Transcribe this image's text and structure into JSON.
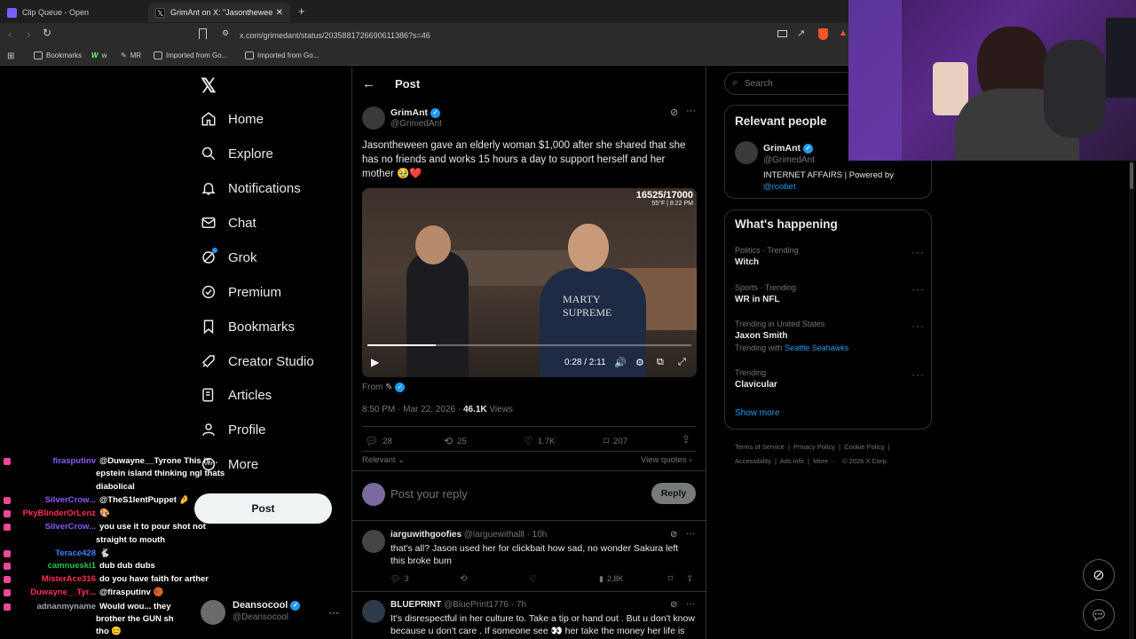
{
  "browser": {
    "tabs": [
      {
        "label": "Clip Queue - Open"
      },
      {
        "label": "GrimAnt on X: \"Jasontheween ga"
      }
    ],
    "url": "x.com/grimedant/status/2035881726690611386?s=46",
    "bookmarks": [
      "Bookmarks",
      "w",
      "MR",
      "Imported from Go...",
      "Imported from Go..."
    ]
  },
  "nav": {
    "items": [
      "Home",
      "Explore",
      "Notifications",
      "Chat",
      "Grok",
      "Premium",
      "Bookmarks",
      "Creator Studio",
      "Articles",
      "Profile",
      "More"
    ],
    "post_button": "Post"
  },
  "header": {
    "title": "Post"
  },
  "tweet": {
    "author": "GrimAnt",
    "handle": "@GrimedAnt",
    "text": "Jasontheween gave an elderly woman $1,000 after she shared that she has no friends and works 15 hours a day to support herself and her mother 🥹❤️",
    "video": {
      "overlay_count": "16525/17000",
      "overlay_meta": "55°F | 8:22 PM",
      "shirt_text_1": "MARTY",
      "shirt_text_2": "SUPREME",
      "time": "0:28 / 2:11",
      "progress": 0.21
    },
    "from_label": "From",
    "timestamp": "8:50 PM · Mar 22, 2026 ·",
    "views_count": "46.1K",
    "views_label": "Views",
    "stats": {
      "replies": "28",
      "reposts": "25",
      "likes": "1.7K",
      "bookmarks": "207"
    },
    "sort_label": "Relevant",
    "view_quotes": "View quotes"
  },
  "reply_box": {
    "placeholder": "Post your reply",
    "button": "Reply"
  },
  "replies": [
    {
      "name": "iarguwithgoofies",
      "handle": "@larguewithalll",
      "time": "· 10h",
      "text": "that's all? Jason used her for clickbait how sad, no wonder Sakura left this broke bum",
      "replies": "3",
      "views": "2.8K"
    },
    {
      "name": "BLUEPRINT",
      "handle": "@BluePrint1776",
      "time": "· 7h",
      "text": "It's disrespectful in her culture  to. Take a tip or hand out . But u don't know because u don't care . If someone see 👀  her take the money  her life is"
    }
  ],
  "sidebar_account": {
    "name": "Deansocool",
    "handle": "@Deansocool"
  },
  "right": {
    "search_placeholder": "Search",
    "relevant_title": "Relevant people",
    "relevant_person": {
      "name": "GrimAnt",
      "handle": "@GrimedAnt",
      "bio": "INTERNET AFFAIRS | Powered by",
      "bio_link": "@roobet"
    },
    "happening_title": "What's happening",
    "trends": [
      {
        "category": "Politics · Trending",
        "name": "Witch"
      },
      {
        "category": "Sports · Trending",
        "name": "WR in NFL"
      },
      {
        "category": "Trending in United States",
        "name": "Jaxon Smith",
        "extra_prefix": "Trending with",
        "extra_link": "Seattle Seahawks"
      },
      {
        "category": "Trending",
        "name": "Clavicular"
      }
    ],
    "show_more": "Show more",
    "footer": [
      "Terms of Service",
      "Privacy Policy",
      "Cookie Policy",
      "Accessibility",
      "Ads info",
      "More ···",
      "© 2026 X Corp."
    ]
  },
  "chat": [
    {
      "user": "firasputinv",
      "color": "#8a5cf6",
      "msg": "@Duwayne__Tyrone This is..."
    },
    {
      "user": "",
      "color": "#fff",
      "msg": "epstein island thinking ngl thats"
    },
    {
      "user": "",
      "color": "#fff",
      "msg": "diabolical"
    },
    {
      "user": "SilverCrow...",
      "color": "#8a5cf6",
      "msg": "@TheS1lentPuppet 🤌"
    },
    {
      "user": "PkyBlinderOrLenz",
      "color": "#ff2d55",
      "msg": "🎨"
    },
    {
      "user": "SilverCrow...",
      "color": "#8a5cf6",
      "msg": "you use it to pour shot not"
    },
    {
      "user": "",
      "color": "#fff",
      "msg": "straight to mouth"
    },
    {
      "user": "Terace428",
      "color": "#3b82f6",
      "msg": "🐇"
    },
    {
      "user": "camnueski1",
      "color": "#22c55e",
      "msg": "dub dub dubs"
    },
    {
      "user": "MisterAce316",
      "color": "#ff2d55",
      "msg": "do you have faith for arther"
    },
    {
      "user": "Duwayne__Tyr...",
      "color": "#ff2d55",
      "msg": "@firasputinv 🏀"
    },
    {
      "user": "adnanmyname",
      "color": "#9ca3af",
      "msg": "Would wou... they"
    },
    {
      "user": "",
      "color": "#fff",
      "msg": "brother the GUN sh"
    },
    {
      "user": "",
      "color": "#fff",
      "msg": "tho 😊"
    }
  ],
  "colors": {
    "accent": "#1d9bf0",
    "bg": "#000000",
    "border": "#2f3336",
    "muted": "#71767b"
  }
}
